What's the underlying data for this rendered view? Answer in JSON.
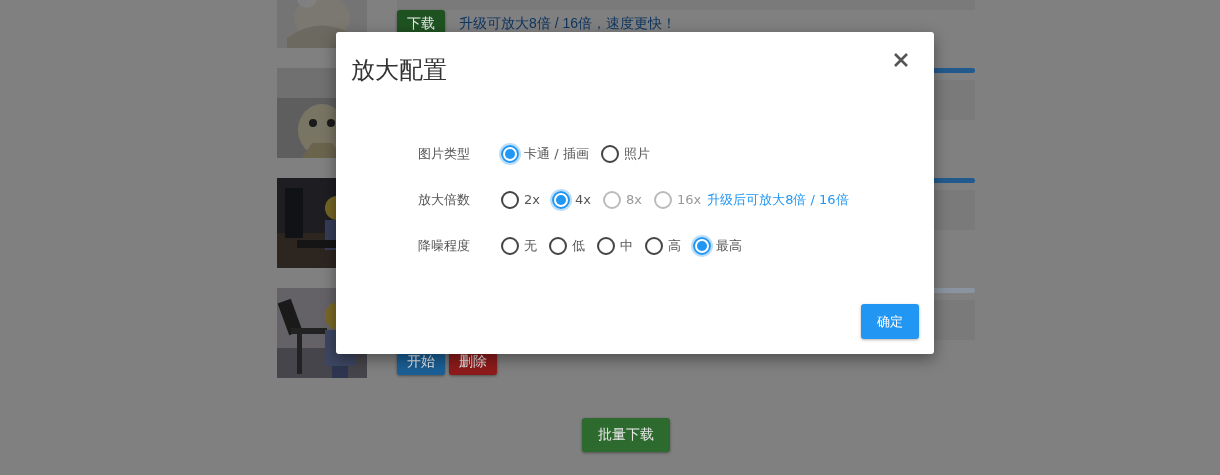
{
  "page": {
    "tasks": [
      {
        "buttons": [
          {
            "label": "下载",
            "kind": "success"
          }
        ],
        "link": "升级可放大8倍 / 16倍，速度更快！"
      },
      {
        "progress": {
          "level": 1
        }
      },
      {
        "progress": {
          "level": 1
        }
      },
      {
        "progress": {
          "level": 0
        },
        "buttons": [
          {
            "label": "开始",
            "kind": "primary"
          },
          {
            "label": "删除",
            "kind": "danger"
          }
        ]
      }
    ],
    "batch_button": "批量下载"
  },
  "dialog": {
    "title": "放大配置",
    "fields": [
      {
        "label": "图片类型",
        "options": [
          {
            "label": "卡通 / 插画",
            "selected": true,
            "disabled": false
          },
          {
            "label": "照片",
            "selected": false,
            "disabled": false
          }
        ]
      },
      {
        "label": "放大倍数",
        "options": [
          {
            "label": "2x",
            "selected": false,
            "disabled": false
          },
          {
            "label": "4x",
            "selected": true,
            "disabled": false
          },
          {
            "label": "8x",
            "selected": false,
            "disabled": true
          },
          {
            "label": "16x",
            "selected": false,
            "disabled": true
          }
        ],
        "note": "升级后可放大8倍 / 16倍"
      },
      {
        "label": "降噪程度",
        "options": [
          {
            "label": "无",
            "selected": false,
            "disabled": false
          },
          {
            "label": "低",
            "selected": false,
            "disabled": false
          },
          {
            "label": "中",
            "selected": false,
            "disabled": false
          },
          {
            "label": "高",
            "selected": false,
            "disabled": false
          },
          {
            "label": "最高",
            "selected": true,
            "disabled": false
          }
        ]
      }
    ],
    "confirm": "确定"
  }
}
